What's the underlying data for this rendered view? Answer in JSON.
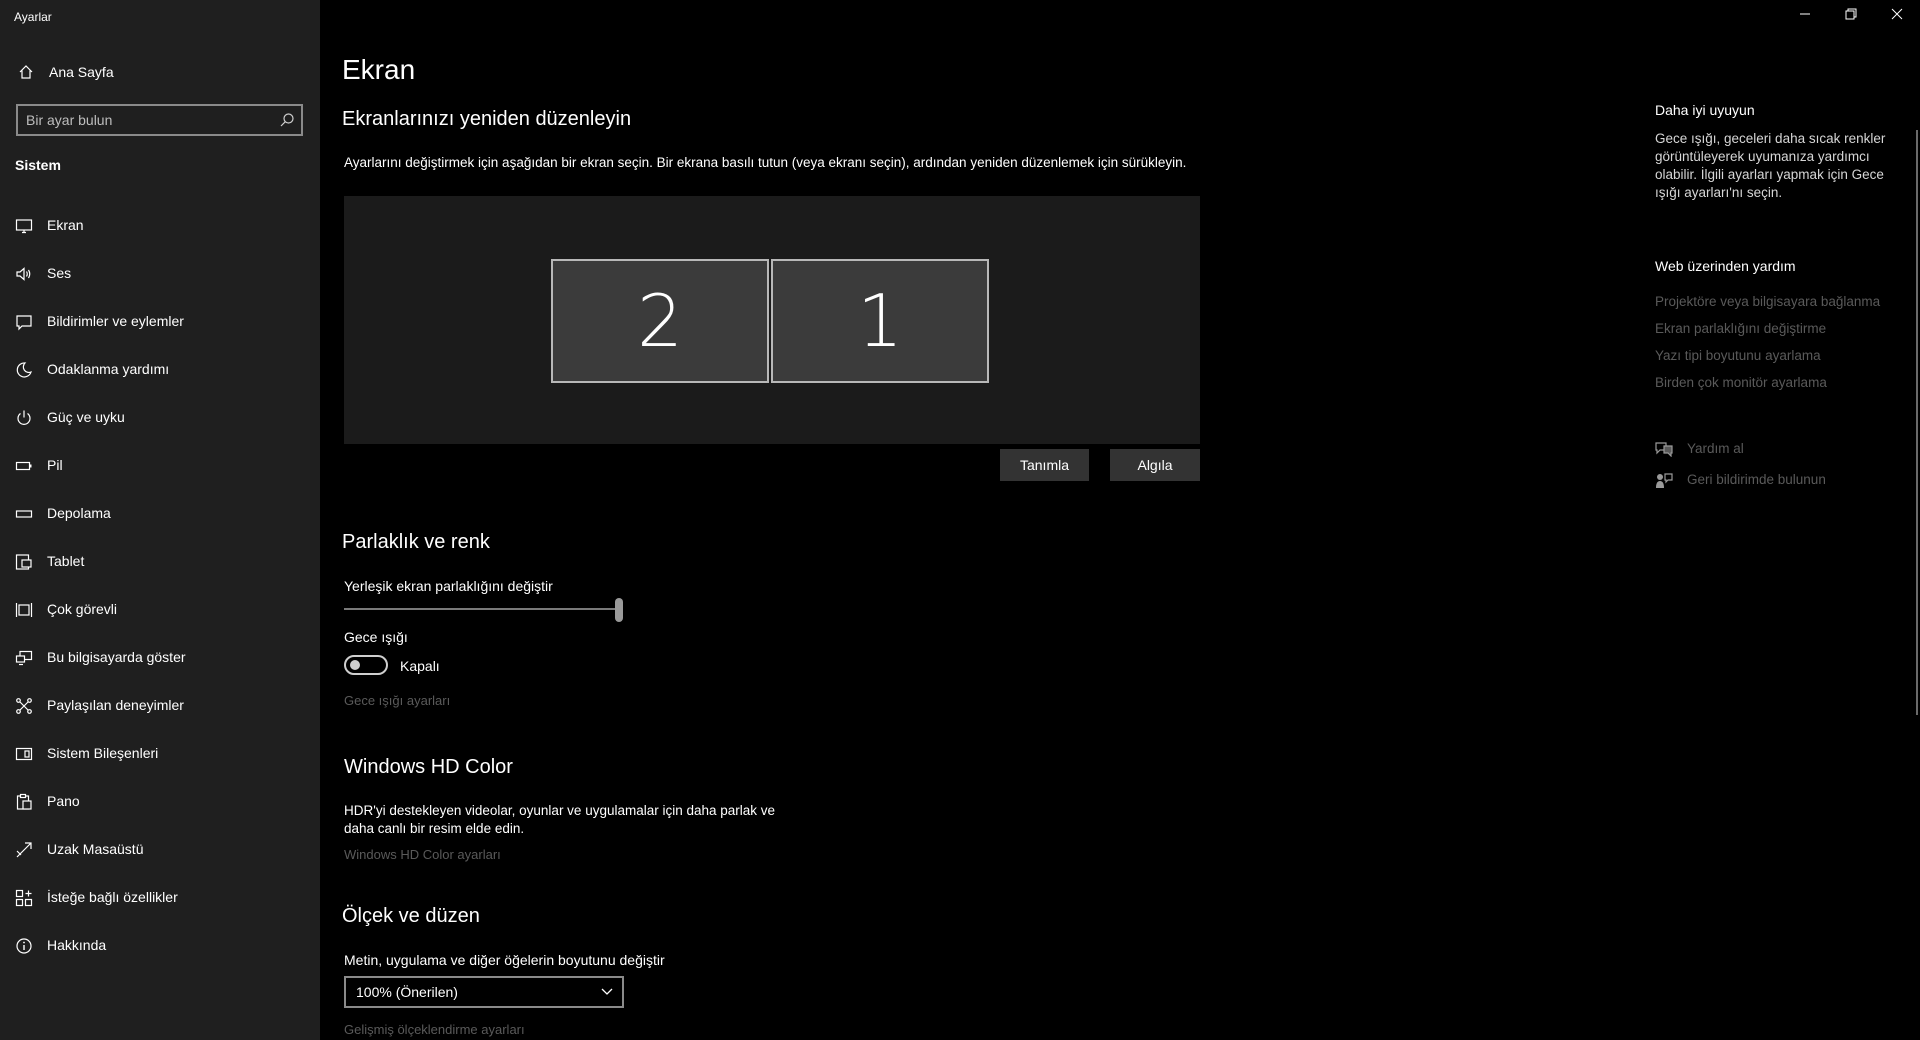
{
  "window": {
    "app_title": "Ayarlar",
    "controls": [
      "minimize-icon",
      "restore-icon",
      "close-icon"
    ]
  },
  "sidebar": {
    "home_label": "Ana Sayfa",
    "search_placeholder": "Bir ayar bulun",
    "section_label": "Sistem",
    "items": [
      {
        "label": "Ekran",
        "icon": "monitor-icon",
        "selected": true
      },
      {
        "label": "Ses",
        "icon": "speaker-icon"
      },
      {
        "label": "Bildirimler ve eylemler",
        "icon": "notification-icon"
      },
      {
        "label": "Odaklanma yardımı",
        "icon": "moon-icon"
      },
      {
        "label": "Güç ve uyku",
        "icon": "power-icon"
      },
      {
        "label": "Pil",
        "icon": "battery-icon"
      },
      {
        "label": "Depolama",
        "icon": "storage-icon"
      },
      {
        "label": "Tablet",
        "icon": "tablet-icon"
      },
      {
        "label": "Çok görevli",
        "icon": "multitasking-icon"
      },
      {
        "label": "Bu bilgisayarda göster",
        "icon": "project-icon"
      },
      {
        "label": "Paylaşılan deneyimler",
        "icon": "shared-icon"
      },
      {
        "label": "Sistem Bileşenleri",
        "icon": "components-icon"
      },
      {
        "label": "Pano",
        "icon": "clipboard-icon"
      },
      {
        "label": "Uzak Masaüstü",
        "icon": "remote-desktop-icon"
      },
      {
        "label": "İsteğe bağlı özellikler",
        "icon": "optional-features-icon"
      },
      {
        "label": "Hakkında",
        "icon": "info-icon"
      }
    ]
  },
  "main": {
    "title": "Ekran",
    "rearrange": {
      "heading": "Ekranlarınızı yeniden düzenleyin",
      "description": "Ayarlarını değiştirmek için aşağıdan bir ekran seçin. Bir ekrana basılı tutun (veya ekranı seçin), ardından yeniden düzenlemek için sürükleyin.",
      "monitors": [
        "2",
        "1"
      ],
      "identify_button": "Tanımla",
      "detect_button": "Algıla"
    },
    "brightness": {
      "heading": "Parlaklık ve renk",
      "slider_label": "Yerleşik ekran parlaklığını değiştir",
      "slider_value": 1.0,
      "night_light_label": "Gece ışığı",
      "night_light_state": "Kapalı",
      "night_light_on": false,
      "night_light_settings": "Gece ışığı ayarları"
    },
    "hdr": {
      "heading": "Windows HD Color",
      "description_line1": "HDR'yi destekleyen videolar, oyunlar ve uygulamalar için daha parlak ve",
      "description_line2": "daha canlı bir resim elde edin.",
      "settings_link": "Windows HD Color ayarları"
    },
    "scale": {
      "heading": "Ölçek ve düzen",
      "label": "Metin, uygulama ve diğer öğelerin boyutunu değiştir",
      "selected": "100% (Önerilen)",
      "advanced_link": "Gelişmiş ölçeklendirme ayarları"
    }
  },
  "right_panel": {
    "fit_title": "Daha iyi uyuyun",
    "fit_text": [
      "Gece ışığı, geceleri daha sıcak renkler",
      "görüntüleyerek uyumanıza yardımcı",
      "olabilir. İlgili ayarları yapmak için Gece",
      "ışığı ayarları'nı seçin."
    ],
    "web_help_title": "Web üzerinden yardım",
    "web_links": [
      "Projektöre veya bilgisayara bağlanma",
      "Ekran parlaklığını değiştirme",
      "Yazı tipi boyutunu ayarlama",
      "Birden çok monitör ayarlama"
    ],
    "get_help": "Yardım al",
    "feedback": "Geri bildirimde bulunun"
  }
}
